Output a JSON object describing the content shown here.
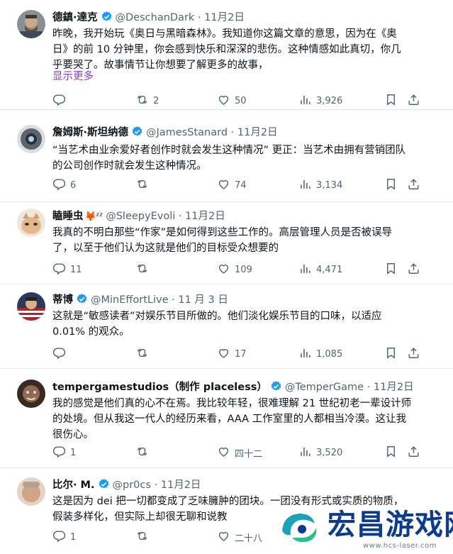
{
  "tweets": [
    {
      "name": "德鎮·達克",
      "verified": true,
      "handle": "@DeschanDark",
      "sep": "·",
      "time": "11月2日",
      "lines": [
        "昨晚，我开始玩《奥日与黑暗森林》。我知道你这篇文章的意思，因为在《奥",
        "日》的前 10 分钟里，你会感到快乐和深深的悲伤。这种情感如此真切，你几",
        "乎要哭了。故事情节让你想要了解更多的故事，"
      ],
      "show_more": "显示更多",
      "replies": "",
      "retweets": "2",
      "likes": "50",
      "views": "3,926"
    },
    {
      "name": "詹姆斯·斯坦纳德",
      "verified": true,
      "handle": "@JamesStanard",
      "sep": "·",
      "time": "11月2日",
      "lines": [
        "“当艺术由业余爱好者创作时就会发生这种情况” 更正：当艺术由拥有营销团队",
        "的公司创作时就会发生这种情况。"
      ],
      "show_more": "",
      "replies": "6",
      "retweets": "",
      "likes": "74",
      "views": "3,134"
    },
    {
      "name": "瞌睡虫",
      "emoji": "🦊ᶻᶻ",
      "verified": false,
      "handle": "@SleepyEvoli",
      "sep": "·",
      "time": "11月2日",
      "lines": [
        "我真的不明白那些“作家”是如何得到这些工作的。高层管理人员是否被误导",
        "了，以至于他们认为这就是他们的目标受众想要的"
      ],
      "show_more": "",
      "replies": "11",
      "retweets": "",
      "likes": "109",
      "views": "4,471"
    },
    {
      "name": "蒂博",
      "verified": true,
      "handle": "@MinEffortLive",
      "sep": "·",
      "time": "11 月 3 日",
      "lines": [
        "这就是“敏感读者”对娱乐节目所做的。他们淡化娱乐节目的口味，以适应",
        "0.01% 的观众。"
      ],
      "show_more": "",
      "replies": "",
      "retweets": "",
      "likes": "17",
      "views": "1,085"
    },
    {
      "name": "tempergamestudios（制作 placeless）",
      "verified": true,
      "handle": "@TemperGame",
      "sep": "·",
      "time": "11月2日",
      "lines": [
        "我的感觉是他们真的心不在焉。我比较年轻，很难理解 21 世纪初老一辈设计师",
        "的处境。但从我这一代人的经历来看，AAA 工作室里的人都相当冷漠。这让我",
        "很伤心。"
      ],
      "show_more": "",
      "replies": "1",
      "retweets": "",
      "likes": "四十二",
      "views": "3,520"
    },
    {
      "name": "比尔· M.",
      "verified": true,
      "handle": "@pr0cs",
      "sep": "·",
      "time": "11月2日",
      "lines": [
        "这是因为 dei 把一切都变成了乏味臃肿的团块。一团没有形式或实质的物质，",
        "假装多样化，但实际上却很无聊和说教"
      ],
      "show_more": "",
      "replies": "1",
      "retweets": "",
      "likes": "二十八",
      "views": ""
    }
  ],
  "watermark": {
    "title": "宏昌游戏网",
    "url": "www.hcs-laser.com"
  },
  "colors": {
    "verified": "#1d9bf0",
    "link": "#8a3fd1",
    "muted": "#536471",
    "brand": "#0b3a8f"
  },
  "icons": [
    "reply-icon",
    "retweet-icon",
    "like-icon",
    "views-icon",
    "bookmark-icon",
    "share-icon",
    "verified-badge-icon"
  ]
}
